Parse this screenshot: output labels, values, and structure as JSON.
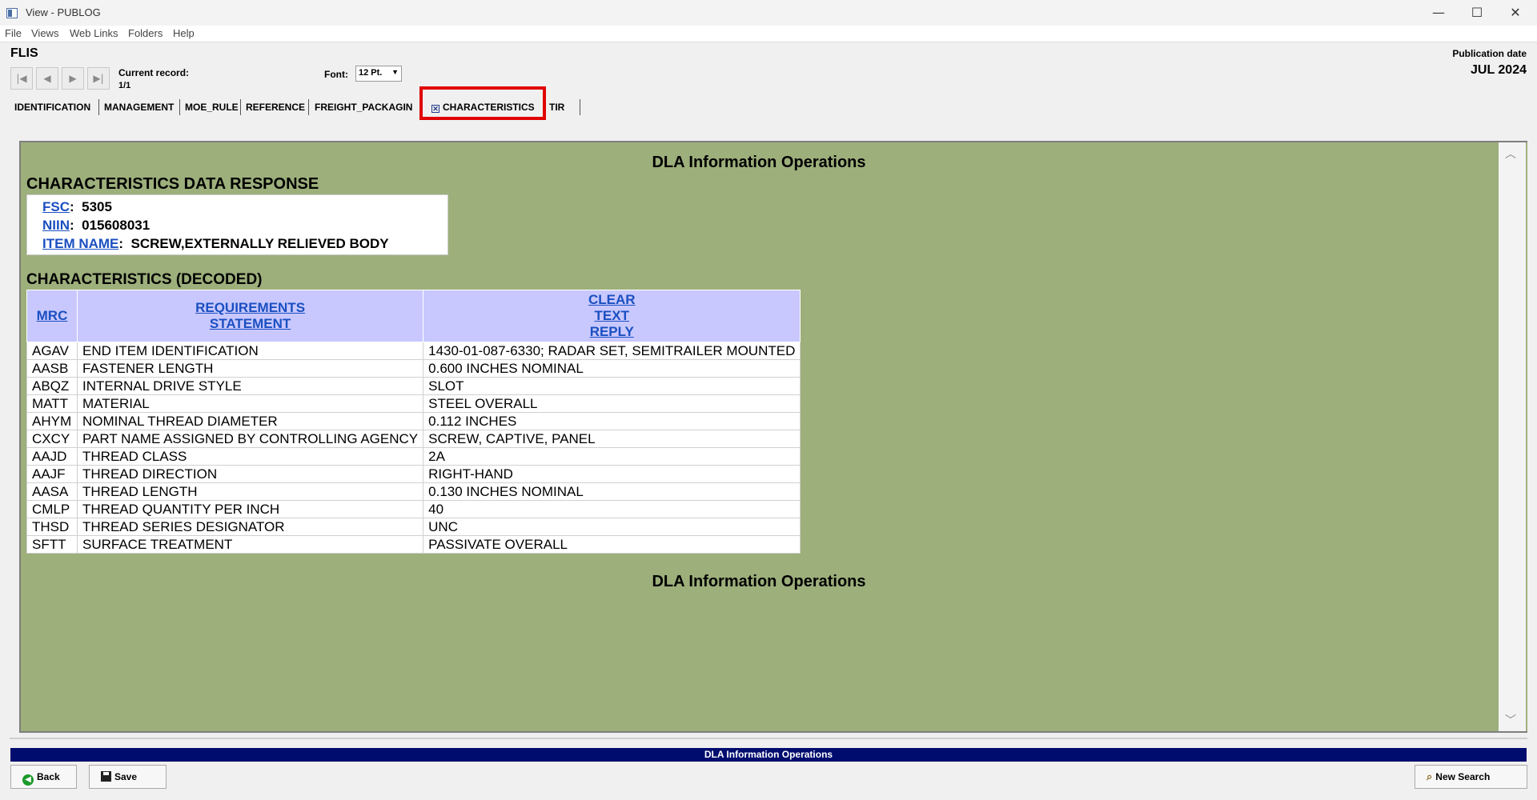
{
  "window": {
    "title": "View - PUBLOG",
    "minimize": "—",
    "maximize": "☐",
    "close": "✕"
  },
  "menu": [
    "File",
    "Views",
    "Web Links",
    "Folders",
    "Help"
  ],
  "header": {
    "section": "FLIS",
    "publication_label": "Publication date",
    "publication_date": "JUL 2024",
    "current_record_label": "Current record:",
    "current_record_value": "1/1",
    "font_label": "Font:",
    "font_value": "12 Pt."
  },
  "nav_icons": [
    "first-record-icon",
    "previous-record-icon",
    "next-record-icon",
    "last-record-icon"
  ],
  "tabs": [
    "IDENTIFICATION",
    "MANAGEMENT",
    "MOE_RULE",
    "REFERENCE",
    "FREIGHT_PACKAGIN",
    "CHARACTERISTICS",
    "TIR"
  ],
  "active_tab": "CHARACTERISTICS",
  "content": {
    "banner_top": "DLA Information Operations",
    "response_title": "CHARACTERISTICS DATA RESPONSE",
    "fsc_label": "FSC",
    "fsc_value": "5305",
    "niin_label": "NIIN",
    "niin_value": "015608031",
    "item_name_label": "ITEM NAME",
    "item_name_value": "SCREW,EXTERNALLY RELIEVED BODY",
    "decoded_title": "CHARACTERISTICS (DECODED)",
    "table_headers": {
      "mrc": "MRC",
      "req_line1": "REQUIREMENTS",
      "req_line2": "STATEMENT",
      "reply_line1": "CLEAR",
      "reply_line2": "TEXT",
      "reply_line3": "REPLY"
    },
    "rows": [
      {
        "mrc": "AGAV",
        "req": "END ITEM IDENTIFICATION",
        "reply": "1430-01-087-6330; RADAR SET, SEMITRAILER MOUNTED"
      },
      {
        "mrc": "AASB",
        "req": "FASTENER LENGTH",
        "reply": "0.600 INCHES NOMINAL"
      },
      {
        "mrc": "ABQZ",
        "req": "INTERNAL DRIVE STYLE",
        "reply": "SLOT"
      },
      {
        "mrc": "MATT",
        "req": "MATERIAL",
        "reply": "STEEL OVERALL"
      },
      {
        "mrc": "AHYM",
        "req": "NOMINAL THREAD DIAMETER",
        "reply": "0.112 INCHES"
      },
      {
        "mrc": "CXCY",
        "req": "PART NAME ASSIGNED BY CONTROLLING AGENCY",
        "reply": "SCREW, CAPTIVE, PANEL"
      },
      {
        "mrc": "AAJD",
        "req": "THREAD CLASS",
        "reply": "2A"
      },
      {
        "mrc": "AAJF",
        "req": "THREAD DIRECTION",
        "reply": "RIGHT-HAND"
      },
      {
        "mrc": "AASA",
        "req": "THREAD LENGTH",
        "reply": "0.130 INCHES NOMINAL"
      },
      {
        "mrc": "CMLP",
        "req": "THREAD QUANTITY PER INCH",
        "reply": "40"
      },
      {
        "mrc": "THSD",
        "req": "THREAD SERIES DESIGNATOR",
        "reply": "UNC"
      },
      {
        "mrc": "SFTT",
        "req": "SURFACE TREATMENT",
        "reply": "PASSIVATE OVERALL"
      }
    ],
    "banner_bottom": "DLA Information Operations"
  },
  "footer": {
    "status": "DLA Information Operations",
    "back_label": "Back",
    "save_label": "Save",
    "new_search_label": "New Search"
  },
  "colors": {
    "content_background": "#9daf7b",
    "table_header": "#c8c8ff",
    "status_bar": "#000c6e",
    "active_tab_highlight": "#e00000",
    "link": "#1a4fc0"
  }
}
